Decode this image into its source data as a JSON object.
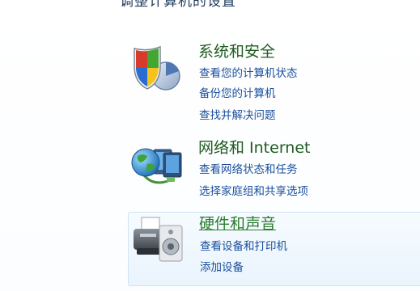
{
  "header": {
    "title": "调整计算机的设置"
  },
  "categories": [
    {
      "title": "系统和安全",
      "icon": "shield-icon",
      "links": [
        "查看您的计算机状态",
        "备份您的计算机",
        "查找并解决问题"
      ]
    },
    {
      "title": "网络和 Internet",
      "icon": "network-globe-icon",
      "links": [
        "查看网络状态和任务",
        "选择家庭组和共享选项"
      ]
    },
    {
      "title": "硬件和声音",
      "icon": "printer-speaker-icon",
      "links": [
        "查看设备和打印机",
        "添加设备"
      ]
    }
  ],
  "colors": {
    "category_title": "#1e5b1e",
    "link": "#1a4f9c",
    "hover_border": "#cfe3f6"
  }
}
